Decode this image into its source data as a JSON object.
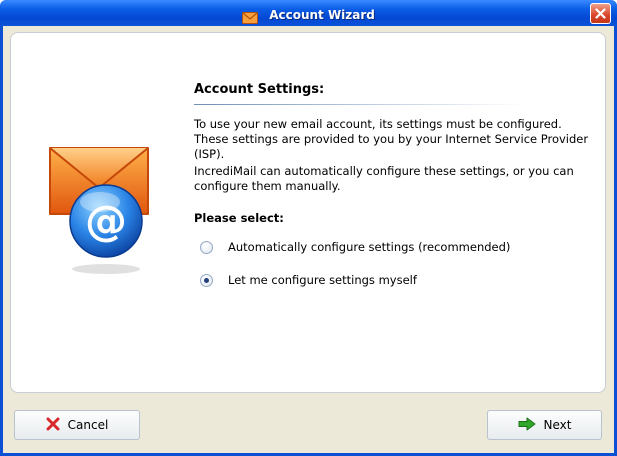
{
  "window": {
    "title": "Account Wizard",
    "title_icon": "envelope-icon",
    "close_icon": "close-icon"
  },
  "content": {
    "heading": "Account Settings:",
    "paragraph1_line1": "To use your new email account, its settings must be configured.",
    "paragraph1_line2": "These settings are provided to you by your Internet Service Provider (ISP).",
    "paragraph2_line1": "IncrediMail can automatically configure these settings, or you can",
    "paragraph2_line2": "configure them manually.",
    "select_label": "Please select:",
    "options": [
      {
        "label": "Automatically configure settings (recommended)",
        "checked": false
      },
      {
        "label": "Let me configure settings myself",
        "checked": true
      }
    ],
    "illustration": "email-at-icon"
  },
  "buttons": {
    "cancel_label": "Cancel",
    "next_label": "Next"
  },
  "colors": {
    "titlebar": "#0b5de6",
    "client_bg": "#ece9d8",
    "envelope_orange": "#f07a1a",
    "globe_blue": "#1a6fd6",
    "cancel_red": "#d8282a",
    "next_green": "#2fa82a"
  }
}
